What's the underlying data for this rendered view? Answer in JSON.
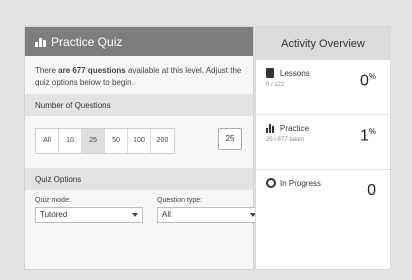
{
  "quiz": {
    "title": "Practice Quiz",
    "intro_prefix": "There ",
    "intro_bold": "are 677 questions",
    "intro_suffix": " available at this level. Adjust the quiz options below to begin.",
    "number_section": "Number of Questions",
    "counts": [
      "All",
      "10",
      "25",
      "50",
      "100",
      "200"
    ],
    "selected_count": "25",
    "custom_count": "25",
    "options_section": "Quiz Options",
    "mode_label": "Quiz mode:",
    "mode_value": "Tutored",
    "type_label": "Question type:",
    "type_value": "All"
  },
  "activity": {
    "title": "Activity Overview",
    "lessons": {
      "label": "Lessons",
      "sub": "0 / 122",
      "value": "0",
      "unit": "%"
    },
    "practice": {
      "label": "Practice",
      "sub": "25 / 677 taken",
      "value": "1",
      "unit": "%"
    },
    "in_progress": {
      "label": "In Progress",
      "value": "0"
    }
  },
  "icons": {
    "quiz": "bar-chart-icon",
    "lessons": "book-icon",
    "practice": "bar-chart-icon",
    "progress": "circle-icon"
  }
}
